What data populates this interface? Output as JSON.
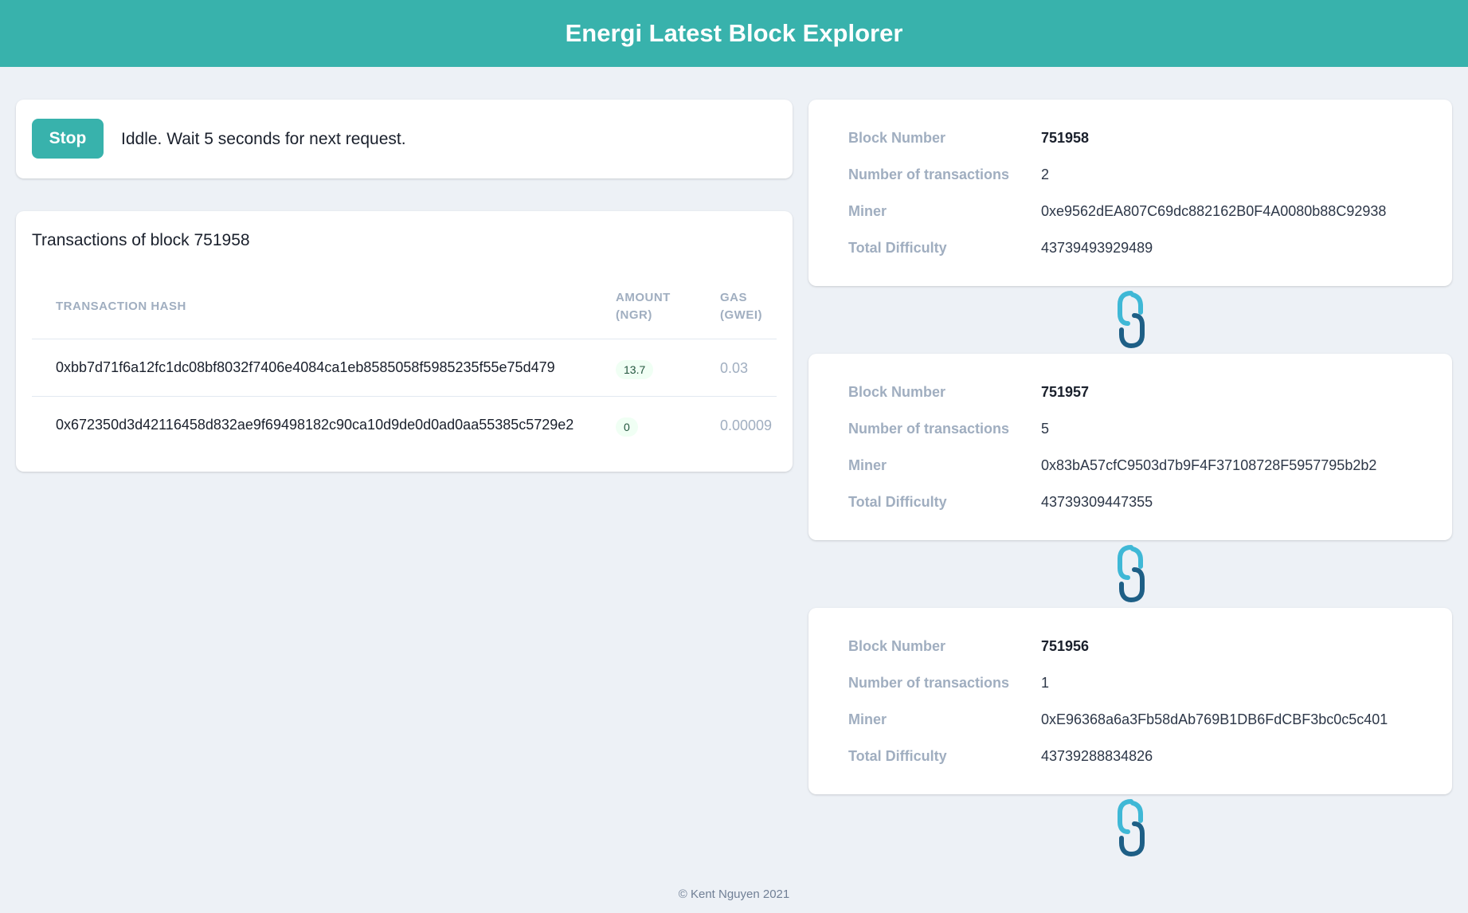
{
  "header": {
    "title": "Energi Latest Block Explorer"
  },
  "control": {
    "stop_label": "Stop",
    "status": "Iddle. Wait 5 seconds for next request."
  },
  "transactions": {
    "title": "Transactions of block 751958",
    "columns": {
      "hash": "TRANSACTION HASH",
      "amount_line1": "AMOUNT",
      "amount_line2": "(NGR)",
      "gas_line1": "GAS",
      "gas_line2": "(GWEI)"
    },
    "rows": [
      {
        "hash": "0xbb7d71f6a12fc1dc08bf8032f7406e4084ca1eb8585058f5985235f55e75d479",
        "amount": "13.7",
        "gas": "0.03"
      },
      {
        "hash": "0x672350d3d42116458d832ae9f69498182c90ca10d9de0d0ad0aa55385c5729e2",
        "amount": "0",
        "gas": "0.00009"
      }
    ]
  },
  "block_labels": {
    "number": "Block Number",
    "tx_count": "Number of transactions",
    "miner": "Miner",
    "difficulty": "Total Difficulty"
  },
  "blocks": [
    {
      "number": "751958",
      "tx_count": "2",
      "miner": "0xe9562dEA807C69dc882162B0F4A0080b88C92938",
      "difficulty": "43739493929489"
    },
    {
      "number": "751957",
      "tx_count": "5",
      "miner": "0x83bA57cfC9503d7b9F4F37108728F5957795b2b2",
      "difficulty": "43739309447355"
    },
    {
      "number": "751956",
      "tx_count": "1",
      "miner": "0xE96368a6a3Fb58dAb769B1DB6FdCBF3bc0c5c401",
      "difficulty": "43739288834826"
    }
  ],
  "footer": {
    "text": "© Kent Nguyen 2021"
  },
  "colors": {
    "accent": "#38b2ac",
    "background": "#edf1f6",
    "chain_light": "#3fb8d6",
    "chain_dark": "#1e5f86"
  }
}
